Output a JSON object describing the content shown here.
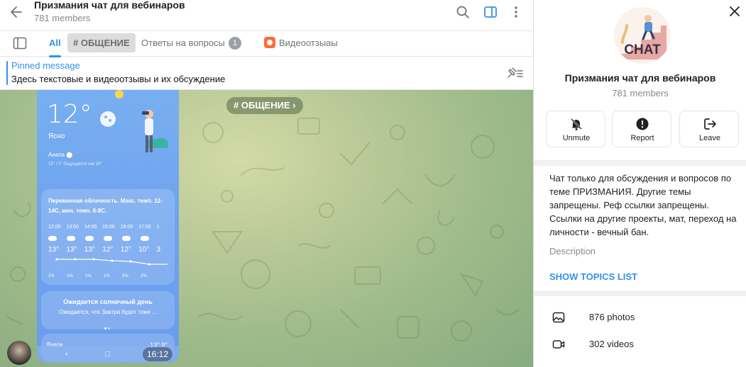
{
  "header": {
    "title": "Призмания чат для вебинаров",
    "subtitle": "781 members",
    "icons": [
      "back-arrow-icon",
      "search-icon",
      "sidebar-panel-icon",
      "more-vertical-icon"
    ]
  },
  "tabs": {
    "items": [
      {
        "label": "All",
        "active": true
      },
      {
        "label": "# ОБЩЕНИЕ"
      },
      {
        "label": "Ответы на вопросы",
        "badge": "1"
      },
      {
        "label": "Видеоотзыаы",
        "icon": "topic-orange-icon"
      }
    ]
  },
  "pinned": {
    "title": "Pinned message",
    "text": "Здесь текстовые и видеоотзывы и их обсуждение"
  },
  "message": {
    "topic_label": "# ОБЩЕНИЕ ›",
    "time": "16:12",
    "phone": {
      "temp": "12°",
      "condition": "Ясно",
      "city": "Анапа",
      "range": "13° / 7° Ощущается как 10°",
      "forecast": "Переменная облачность. Макс. темп. 12-14С, мин. темп. 6-8С.",
      "hours": [
        "12:00",
        "13:00",
        "14:00",
        "15:00",
        "16:00",
        "17:00",
        "1"
      ],
      "temps": [
        "13°",
        "13°",
        "13°",
        "12°",
        "12°",
        "10°",
        "3"
      ],
      "precip": [
        "1%",
        "1%",
        "1%",
        "1%",
        "2%",
        "2%"
      ],
      "sunny_title": "Ожидается солнечный день",
      "sunny_sub": "Ожидается, что Завтра будет тоже ...",
      "yesterday": "Вчера",
      "yesterday_temps": "13° 9°"
    }
  },
  "sidebar": {
    "name": "Призмания чат для вебинаров",
    "members": "781 members",
    "avatar_text": "CHAT",
    "actions": [
      {
        "label": "Unmute",
        "icon": "bell-muted-icon"
      },
      {
        "label": "Report",
        "icon": "alert-circle-icon"
      },
      {
        "label": "Leave",
        "icon": "leave-icon"
      }
    ],
    "description": "Чат только для обсуждения и вопросов по теме ПРИЗМАНИЯ. Другие темы запрещены. Реф ссылки запрещены. Ссылки на другие проекты, мат, переход на личности - вечный бан.",
    "description_label": "Description",
    "show_topics": "SHOW TOPICS LIST",
    "media": [
      {
        "label": "876 photos",
        "icon": "photo-icon"
      },
      {
        "label": "302 videos",
        "icon": "video-icon"
      }
    ]
  },
  "colors": {
    "accent": "#3390ec",
    "topic_icon": "#ff6b35"
  }
}
